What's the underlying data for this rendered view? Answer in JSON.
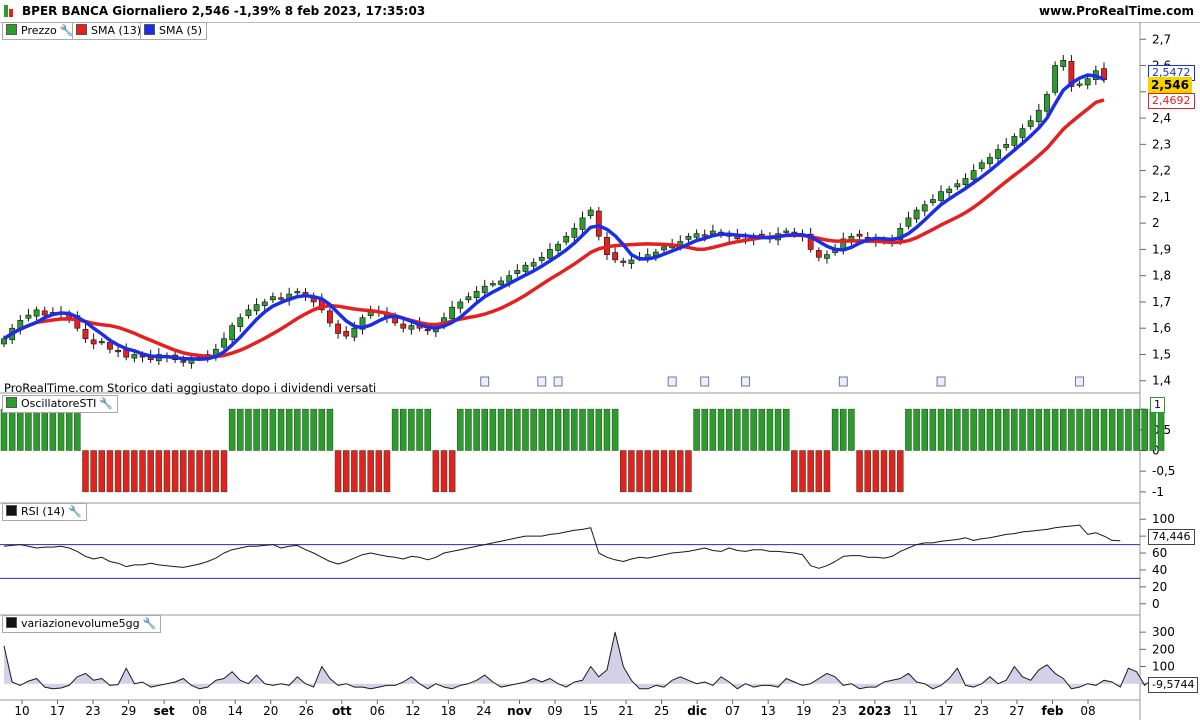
{
  "header": {
    "title": "BPER BANCA Giornaliero 2,546 -1,39% 8 feb 2023, 17:35:03",
    "site": "www.ProRealTime.com"
  },
  "legend_price": [
    {
      "label": "Prezzo",
      "color": "#2e9b2e",
      "icon": "wrench-icon"
    },
    {
      "label": "SMA (13)",
      "color": "#e52020"
    },
    {
      "label": "SMA (5)",
      "color": "#1a2ee8"
    }
  ],
  "note": "ProRealTime.com  Storico dati aggiustato dopo i dividendi versati",
  "price_tags": {
    "sma5": "2,5472",
    "last": "2,546",
    "sma13": "2,4692"
  },
  "indicators": {
    "osc_label": "OscillatoreSTI",
    "osc_value": "1",
    "rsi_label": "RSI (14)",
    "rsi_value": "74,446",
    "vol_label": "variazionevolume5gg",
    "vol_value": "-9,5744"
  },
  "chart_data": [
    {
      "type": "candlestick",
      "name": "Prezzo",
      "ylim": [
        1.38,
        2.72
      ],
      "yticks": [
        "1,4",
        "1,5",
        "1,6",
        "1,7",
        "1,8",
        "1,9",
        "2",
        "2,1",
        "2,2",
        "2,3",
        "2,4",
        "2,5",
        "2,6",
        "2,7"
      ],
      "xticks": [
        "10",
        "17",
        "23",
        "29",
        "set",
        "08",
        "14",
        "20",
        "26",
        "ott",
        "06",
        "12",
        "18",
        "24",
        "nov",
        "09",
        "15",
        "21",
        "25",
        "dic",
        "07",
        "13",
        "19",
        "23",
        "2023",
        "11",
        "17",
        "23",
        "27",
        "feb",
        "08"
      ],
      "closes": [
        1.56,
        1.6,
        1.63,
        1.65,
        1.67,
        1.65,
        1.66,
        1.66,
        1.64,
        1.6,
        1.56,
        1.54,
        1.55,
        1.52,
        1.51,
        1.49,
        1.5,
        1.49,
        1.48,
        1.5,
        1.49,
        1.48,
        1.47,
        1.48,
        1.49,
        1.5,
        1.52,
        1.56,
        1.61,
        1.64,
        1.67,
        1.69,
        1.7,
        1.72,
        1.71,
        1.73,
        1.74,
        1.72,
        1.7,
        1.67,
        1.62,
        1.58,
        1.57,
        1.6,
        1.64,
        1.67,
        1.66,
        1.64,
        1.62,
        1.6,
        1.61,
        1.6,
        1.59,
        1.6,
        1.64,
        1.68,
        1.7,
        1.72,
        1.74,
        1.76,
        1.77,
        1.78,
        1.8,
        1.82,
        1.84,
        1.85,
        1.87,
        1.9,
        1.92,
        1.95,
        1.98,
        2.02,
        2.05,
        1.95,
        1.88,
        1.86,
        1.85,
        1.86,
        1.87,
        1.88,
        1.89,
        1.91,
        1.92,
        1.93,
        1.95,
        1.96,
        1.95,
        1.97,
        1.96,
        1.95,
        1.94,
        1.94,
        1.95,
        1.95,
        1.94,
        1.96,
        1.97,
        1.96,
        1.95,
        1.9,
        1.87,
        1.88,
        1.9,
        1.94,
        1.95,
        1.95,
        1.94,
        1.93,
        1.93,
        1.94,
        1.98,
        2.02,
        2.05,
        2.07,
        2.09,
        2.12,
        2.13,
        2.15,
        2.17,
        2.2,
        2.23,
        2.25,
        2.28,
        2.3,
        2.33,
        2.36,
        2.39,
        2.43,
        2.49,
        2.6,
        2.62,
        2.52,
        2.53,
        2.55,
        2.58,
        2.546
      ],
      "series": [
        {
          "name": "SMA (13)",
          "color": "#e52020",
          "last": 2.4692
        },
        {
          "name": "SMA (5)",
          "color": "#1a2ee8",
          "last": 2.5472
        }
      ]
    },
    {
      "type": "bar",
      "name": "OscillatoreSTI",
      "ylim": [
        -1.1,
        1.1
      ],
      "yticks": [
        "1",
        "0,5",
        "0",
        "-0,5",
        "-1"
      ],
      "values": [
        1,
        1,
        1,
        1,
        1,
        1,
        1,
        1,
        1,
        1,
        -1,
        -1,
        -1,
        -1,
        -1,
        -1,
        -1,
        -1,
        -1,
        -1,
        -1,
        -1,
        -1,
        -1,
        -1,
        -1,
        -1,
        -1,
        1,
        1,
        1,
        1,
        1,
        1,
        1,
        1,
        1,
        1,
        1,
        1,
        1,
        -1,
        -1,
        -1,
        -1,
        -1,
        -1,
        -1,
        1,
        1,
        1,
        1,
        1,
        -1,
        -1,
        -1,
        1,
        1,
        1,
        1,
        1,
        1,
        1,
        1,
        1,
        1,
        1,
        1,
        1,
        1,
        1,
        1,
        1,
        1,
        1,
        1,
        -1,
        -1,
        -1,
        -1,
        -1,
        -1,
        -1,
        -1,
        -1,
        1,
        1,
        1,
        1,
        1,
        1,
        1,
        1,
        1,
        1,
        1,
        1,
        -1,
        -1,
        -1,
        -1,
        -1,
        1,
        1,
        1,
        -1,
        -1,
        -1,
        -1,
        -1,
        -1,
        1,
        1,
        1,
        1,
        1,
        1,
        1,
        1,
        1,
        1,
        1,
        1,
        1,
        1,
        1,
        1,
        1,
        1,
        1,
        1,
        1,
        1,
        1,
        1,
        1,
        1,
        1,
        1,
        1,
        1,
        1,
        1
      ]
    },
    {
      "type": "line",
      "name": "RSI (14)",
      "ylim": [
        -5,
        105
      ],
      "yticks": [
        "100",
        "80",
        "60",
        "40",
        "20",
        "0"
      ],
      "levels": [
        70,
        30
      ],
      "values": [
        68,
        69,
        70,
        68,
        66,
        67,
        67,
        68,
        66,
        62,
        56,
        53,
        55,
        50,
        48,
        44,
        46,
        46,
        48,
        46,
        45,
        44,
        43,
        45,
        47,
        50,
        54,
        60,
        64,
        66,
        68,
        68,
        69,
        70,
        66,
        68,
        69,
        64,
        60,
        55,
        50,
        47,
        50,
        54,
        58,
        60,
        58,
        56,
        55,
        53,
        56,
        55,
        52,
        55,
        60,
        62,
        64,
        66,
        68,
        70,
        72,
        74,
        76,
        78,
        80,
        80,
        80,
        82,
        83,
        85,
        87,
        88,
        90,
        60,
        55,
        52,
        50,
        53,
        55,
        54,
        56,
        58,
        60,
        61,
        62,
        64,
        66,
        63,
        62,
        66,
        63,
        62,
        64,
        64,
        62,
        62,
        61,
        60,
        58,
        45,
        42,
        45,
        50,
        56,
        57,
        57,
        55,
        55,
        54,
        56,
        62,
        66,
        70,
        72,
        72,
        74,
        75,
        76,
        78,
        75,
        77,
        78,
        80,
        82,
        83,
        85,
        86,
        87,
        88,
        90,
        91,
        92,
        93,
        82,
        84,
        80,
        75,
        74.446
      ],
      "line_color": "#1a1a1a"
    },
    {
      "type": "area",
      "name": "variazionevolume5gg",
      "ylim": [
        -60,
        330
      ],
      "yticks": [
        "300",
        "200",
        "100",
        "0"
      ],
      "values": [
        220,
        10,
        -10,
        15,
        30,
        -20,
        -30,
        -25,
        -10,
        40,
        60,
        20,
        30,
        -10,
        -5,
        90,
        0,
        10,
        -20,
        -10,
        0,
        10,
        30,
        -10,
        -30,
        -20,
        20,
        30,
        70,
        20,
        0,
        50,
        0,
        -10,
        0,
        -10,
        40,
        0,
        -20,
        100,
        30,
        -10,
        0,
        -20,
        -20,
        -30,
        -20,
        -10,
        -10,
        10,
        40,
        0,
        -30,
        0,
        -20,
        -30,
        -10,
        0,
        20,
        50,
        10,
        -20,
        -10,
        0,
        10,
        30,
        10,
        30,
        0,
        -20,
        10,
        20,
        100,
        40,
        80,
        300,
        100,
        20,
        -30,
        -30,
        -10,
        -20,
        20,
        40,
        20,
        0,
        10,
        -10,
        40,
        10,
        -30,
        0,
        -20,
        -10,
        -10,
        -20,
        30,
        10,
        -10,
        0,
        30,
        60,
        40,
        -10,
        0,
        -30,
        -20,
        -20,
        10,
        20,
        30,
        60,
        10,
        0,
        -30,
        -10,
        30,
        90,
        -10,
        -20,
        0,
        40,
        0,
        20,
        100,
        40,
        20,
        80,
        110,
        60,
        30,
        -30,
        -20,
        0,
        -10,
        20,
        10,
        -20,
        90,
        70,
        -10,
        30,
        -20,
        -9.5744
      ],
      "fill_color": "#d3d0e8",
      "line_color": "#1a1a1a"
    }
  ]
}
